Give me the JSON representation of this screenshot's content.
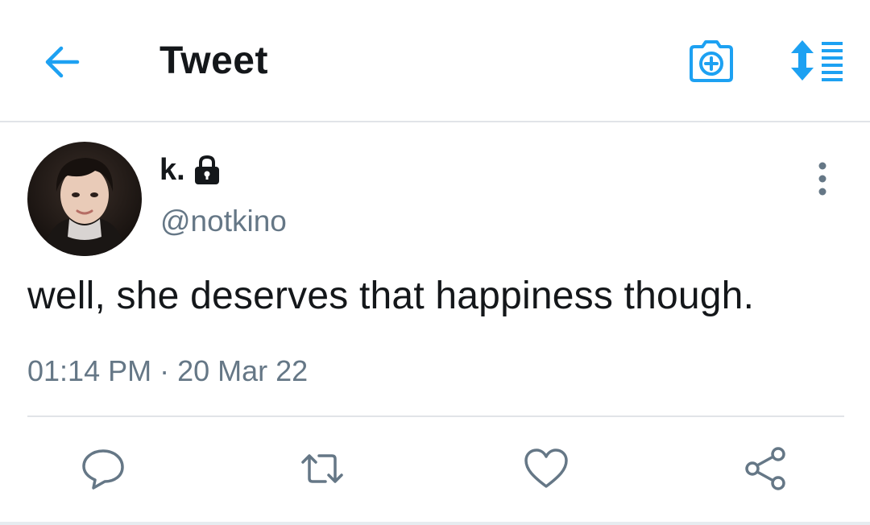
{
  "header": {
    "title": "Tweet",
    "back_icon": "back-arrow-icon",
    "camera_icon": "camera-plus-icon",
    "sort_icon": "sort-list-icon",
    "accent_color": "#1da1f2"
  },
  "tweet": {
    "display_name": "k.",
    "lock_icon": "lock-icon",
    "handle": "@notkino",
    "text": "well, she deserves that happiness though.",
    "time": "01:14 PM",
    "separator": "·",
    "date": "20 Mar 22",
    "more_icon": "vertical-dots-icon"
  },
  "actions": [
    {
      "name": "reply",
      "icon": "reply-bubble-icon"
    },
    {
      "name": "retweet",
      "icon": "retweet-icon"
    },
    {
      "name": "like",
      "icon": "heart-icon"
    },
    {
      "name": "share",
      "icon": "share-icon"
    }
  ],
  "colors": {
    "text_primary": "#14171a",
    "text_secondary": "#657786",
    "icon_gray": "#657786",
    "divider": "#e1e4e8"
  }
}
